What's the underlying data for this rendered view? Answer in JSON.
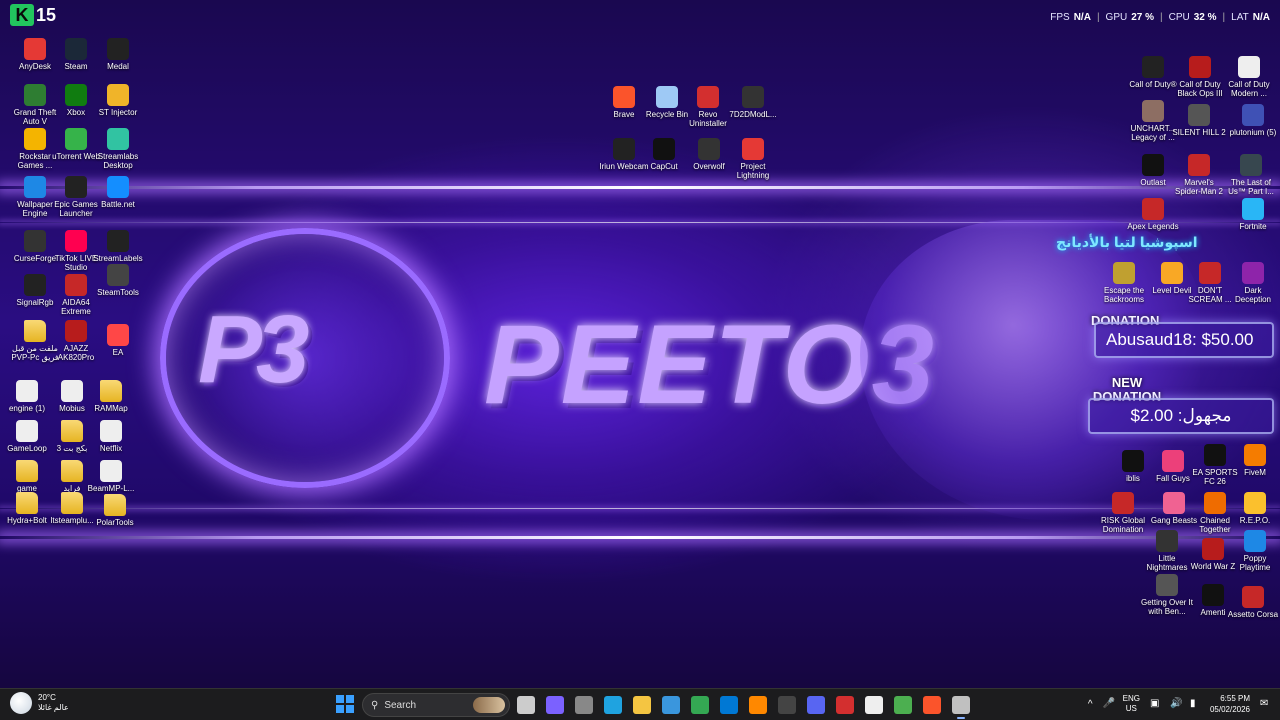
{
  "overlay": {
    "counter_logo": "K",
    "counter_value": "15",
    "fps_label": "FPS",
    "fps_value": "N/A",
    "gpu_label": "GPU",
    "gpu_value": "27 %",
    "cpu_label": "CPU",
    "cpu_value": "32 %",
    "lat_label": "LAT",
    "lat_value": "N/A"
  },
  "wallpaper": {
    "logo_mark": "P3",
    "brand_name": "PEETO3"
  },
  "desktop_left": [
    {
      "label": "AnyDesk",
      "icon": "anydesk-icon",
      "color": "#e53935"
    },
    {
      "label": "Steam",
      "icon": "steam-icon",
      "color": "#1b2838"
    },
    {
      "label": "Medal",
      "icon": "medal-icon",
      "color": "#222222"
    },
    {
      "label": "Grand Theft Auto V",
      "icon": "gta-icon",
      "color": "#2e7d32"
    },
    {
      "label": "Xbox",
      "icon": "xbox-icon",
      "color": "#107c10"
    },
    {
      "label": "ST Injector",
      "icon": "injector-icon",
      "color": "#f0b429"
    },
    {
      "label": "Rockstar Games ...",
      "icon": "rockstar-icon",
      "color": "#f4b400"
    },
    {
      "label": "uTorrent Web",
      "icon": "utorrent-icon",
      "color": "#36b34a"
    },
    {
      "label": "Streamlabs Desktop",
      "icon": "streamlabs-icon",
      "color": "#31c3a2"
    },
    {
      "label": "Wallpaper Engine",
      "icon": "wallpaper-engine-icon",
      "color": "#1e88e5"
    },
    {
      "label": "Epic Games Launcher",
      "icon": "epic-games-icon",
      "color": "#222222"
    },
    {
      "label": "Battle.net",
      "icon": "battlenet-icon",
      "color": "#148eff"
    },
    {
      "label": "CurseForge",
      "icon": "curseforge-icon",
      "color": "#333333"
    },
    {
      "label": "TikTok LIVE Studio",
      "icon": "tiktok-icon",
      "color": "#ff0050"
    },
    {
      "label": "StreamLabels",
      "icon": "streamlabels-icon",
      "color": "#222222"
    },
    {
      "label": "SignalRgb",
      "icon": "signalrgb-icon",
      "color": "#222222"
    },
    {
      "label": "AIDA64 Extreme",
      "icon": "aida64-icon",
      "color": "#c62828"
    },
    {
      "label": "SteamTools",
      "icon": "steamtools-icon",
      "color": "#444444"
    },
    {
      "label": "ملفت من قبل PVP-Pc فريق",
      "icon": "folder-icon",
      "color": "#e6b422"
    },
    {
      "label": "AJAZZ AK820Pro",
      "icon": "ajazz-icon",
      "color": "#b71c1c"
    },
    {
      "label": "EA",
      "icon": "ea-icon",
      "color": "#ff4747"
    },
    {
      "label": "engine (1)",
      "icon": "file-icon",
      "color": "#eeeeee"
    },
    {
      "label": "Mobius",
      "icon": "file-icon",
      "color": "#eeeeee"
    },
    {
      "label": "RAMMap",
      "icon": "folder-icon",
      "color": "#e6b422"
    },
    {
      "label": "GameLoop",
      "icon": "file-icon",
      "color": "#eeeeee"
    },
    {
      "label": "بكج بت 3",
      "icon": "folder-icon",
      "color": "#e6b422"
    },
    {
      "label": "Netflix",
      "icon": "file-icon",
      "color": "#eeeeee"
    },
    {
      "label": "game",
      "icon": "folder-icon",
      "color": "#e6b422"
    },
    {
      "label": "فرايد",
      "icon": "folder-icon",
      "color": "#e6b422"
    },
    {
      "label": "BeamMP-L...",
      "icon": "file-icon",
      "color": "#eeeeee"
    },
    {
      "label": "Hydra+Bolt",
      "icon": "folder-icon",
      "color": "#e6b422"
    },
    {
      "label": "Itsteamplu...",
      "icon": "folder-icon",
      "color": "#e6b422"
    },
    {
      "label": "PolarTools",
      "icon": "folder-icon",
      "color": "#e6b422"
    }
  ],
  "desktop_center": [
    {
      "label": "Brave",
      "icon": "brave-icon",
      "color": "#fb542b"
    },
    {
      "label": "Recycle Bin",
      "icon": "recycle-bin-icon",
      "color": "#9ec9f5"
    },
    {
      "label": "Revo Uninstaller",
      "icon": "revo-icon",
      "color": "#d32f2f"
    },
    {
      "label": "7D2DModL...",
      "icon": "mod-icon",
      "color": "#333333"
    },
    {
      "label": "Iriun Webcam",
      "icon": "iriun-icon",
      "color": "#222222"
    },
    {
      "label": "CapCut",
      "icon": "capcut-icon",
      "color": "#111111"
    },
    {
      "label": "Overwolf",
      "icon": "overwolf-icon",
      "color": "#333333"
    },
    {
      "label": "Project Lightning",
      "icon": "lightning-icon",
      "color": "#e53935"
    }
  ],
  "desktop_right": [
    {
      "label": "Call of Duty®",
      "icon": "cod-icon",
      "color": "#222222"
    },
    {
      "label": "Call of Duty Black Ops III",
      "icon": "cod-bo3-icon",
      "color": "#b71c1c"
    },
    {
      "label": "Call of Duty Modern ...",
      "icon": "file-icon",
      "color": "#eeeeee"
    },
    {
      "label": "UNCHART... Legacy of ...",
      "icon": "uncharted-icon",
      "color": "#8d6e63"
    },
    {
      "label": "SILENT HILL 2",
      "icon": "silent-hill-icon",
      "color": "#555555"
    },
    {
      "label": "plutonium (5)",
      "icon": "plutonium-icon",
      "color": "#3f51b5"
    },
    {
      "label": "Outlast",
      "icon": "outlast-icon",
      "color": "#111111"
    },
    {
      "label": "Marvel's Spider-Man 2",
      "icon": "spiderman-icon",
      "color": "#c62828"
    },
    {
      "label": "The Last of Us™ Part I...",
      "icon": "tlou-icon",
      "color": "#37474f"
    },
    {
      "label": "Apex Legends",
      "icon": "apex-icon",
      "color": "#c62828"
    },
    {
      "label": "Fortnite",
      "icon": "fortnite-icon",
      "color": "#29b6f6"
    },
    {
      "label": "Escape the Backrooms",
      "icon": "backrooms-icon",
      "color": "#c0a030"
    },
    {
      "label": "Level Devil",
      "icon": "level-devil-icon",
      "color": "#f9a825"
    },
    {
      "label": "DON'T SCREAM ...",
      "icon": "dont-scream-icon",
      "color": "#c62828"
    },
    {
      "label": "Dark Deception",
      "icon": "dark-deception-icon",
      "color": "#8e24aa"
    },
    {
      "label": "iblis",
      "icon": "iblis-icon",
      "color": "#111111"
    },
    {
      "label": "Fall Guys",
      "icon": "fall-guys-icon",
      "color": "#ec407a"
    },
    {
      "label": "EA SPORTS FC 26",
      "icon": "fc26-icon",
      "color": "#111111"
    },
    {
      "label": "FiveM",
      "icon": "fivem-icon",
      "color": "#f57c00"
    },
    {
      "label": "RISK Global Domination",
      "icon": "risk-icon",
      "color": "#c62828"
    },
    {
      "label": "Gang Beasts",
      "icon": "gang-beasts-icon",
      "color": "#f06292"
    },
    {
      "label": "Chained Together",
      "icon": "chained-icon",
      "color": "#ef6c00"
    },
    {
      "label": "R.E.P.O.",
      "icon": "repo-icon",
      "color": "#fbc02d"
    },
    {
      "label": "Little Nightmares",
      "icon": "little-nightmares-icon",
      "color": "#333333"
    },
    {
      "label": "World War Z",
      "icon": "wwz-icon",
      "color": "#b71c1c"
    },
    {
      "label": "Poppy Playtime",
      "icon": "poppy-icon",
      "color": "#1e88e5"
    },
    {
      "label": "Getting Over It with Ben...",
      "icon": "getting-over-it-icon",
      "color": "#555555"
    },
    {
      "label": "Amenti",
      "icon": "amenti-icon",
      "color": "#111111"
    },
    {
      "label": "Assetto Corsa",
      "icon": "assetto-icon",
      "color": "#c62828"
    }
  ],
  "donations": {
    "arabic_banner": "اسپوشيا لتيا بالأديانج",
    "label_1": "DONATION",
    "amount_1": "Abusaud18: $50.00",
    "label_2": "NEW DONATION",
    "amount_2": "مجهول: 2.00$"
  },
  "taskbar": {
    "weather_temp": "20°C",
    "weather_desc": "عالم غائلا",
    "search_label": "Search",
    "apps": [
      {
        "name": "task-view-icon",
        "color": "#cccccc"
      },
      {
        "name": "copilot-icon",
        "color": "#7b61ff"
      },
      {
        "name": "widgets-icon",
        "color": "#888888"
      },
      {
        "name": "edge-icon",
        "color": "#1fa3e0"
      },
      {
        "name": "file-explorer-icon",
        "color": "#f4c542"
      },
      {
        "name": "store-icon",
        "color": "#3a96dd"
      },
      {
        "name": "chrome-icon",
        "color": "#34a853"
      },
      {
        "name": "mail-icon",
        "color": "#0078d4"
      },
      {
        "name": "vlc-icon",
        "color": "#ff8800"
      },
      {
        "name": "obs-icon",
        "color": "#444444"
      },
      {
        "name": "discord-icon",
        "color": "#5865f2"
      },
      {
        "name": "streamer-app-icon",
        "color": "#d32f2f"
      },
      {
        "name": "capcut-taskbar-icon",
        "color": "#eeeeee"
      },
      {
        "name": "minecraft-icon",
        "color": "#4caf50"
      },
      {
        "name": "brave-taskbar-icon",
        "color": "#fb542b"
      },
      {
        "name": "steam-taskbar-icon",
        "color": "#c0c0c0"
      }
    ],
    "lang_top": "ENG",
    "lang_bottom": "US",
    "time": "6:55 PM",
    "date": "05/02/2026",
    "tray_chevron": "^"
  },
  "colors": {
    "accent_purple": "#7c3aed",
    "taskbar_bg": "#1c1c1e",
    "banner_cyan": "#7ee8ff"
  }
}
